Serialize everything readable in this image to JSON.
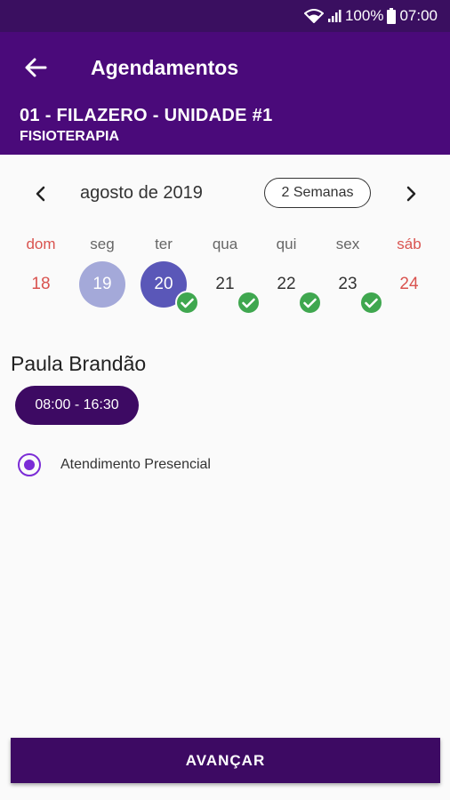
{
  "status_bar": {
    "battery_text": "100%",
    "time": "07:00"
  },
  "app_bar": {
    "title": "Agendamentos",
    "unit_name": "01 - FILAZERO - UNIDADE #1",
    "specialty": "FISIOTERAPIA"
  },
  "calendar": {
    "month_label": "agosto de 2019",
    "range_button": "2 Semanas",
    "days": [
      {
        "dow": "dom",
        "num": "18",
        "weekend": true,
        "state": "none",
        "available": false
      },
      {
        "dow": "seg",
        "num": "19",
        "weekend": false,
        "state": "light",
        "available": false
      },
      {
        "dow": "ter",
        "num": "20",
        "weekend": false,
        "state": "selected",
        "available": true
      },
      {
        "dow": "qua",
        "num": "21",
        "weekend": false,
        "state": "none",
        "available": true
      },
      {
        "dow": "qui",
        "num": "22",
        "weekend": false,
        "state": "none",
        "available": true
      },
      {
        "dow": "sex",
        "num": "23",
        "weekend": false,
        "state": "none",
        "available": true
      },
      {
        "dow": "sáb",
        "num": "24",
        "weekend": true,
        "state": "none",
        "available": false
      }
    ]
  },
  "professional": {
    "name": "Paula Brandão",
    "time_slot": "08:00 - 16:30"
  },
  "service_option": {
    "label": "Atendimento Presencial",
    "selected": true
  },
  "advance_button": "AVANÇAR",
  "colors": {
    "app_bar": "#4a0a7a",
    "status_bar": "#3a0f60",
    "primary_button": "#3d0a63",
    "selected_day": "#5a57b8",
    "today_day": "#a4a9d9",
    "available_check": "#3fa74f",
    "weekend_text": "#d9534f",
    "radio": "#7b2cd6"
  },
  "icons": {
    "back": "arrow-left-icon",
    "prev": "chevron-left-icon",
    "next": "chevron-right-icon",
    "available": "check-circle-icon",
    "wifi": "wifi-icon",
    "signal": "signal-icon",
    "battery": "battery-icon"
  }
}
